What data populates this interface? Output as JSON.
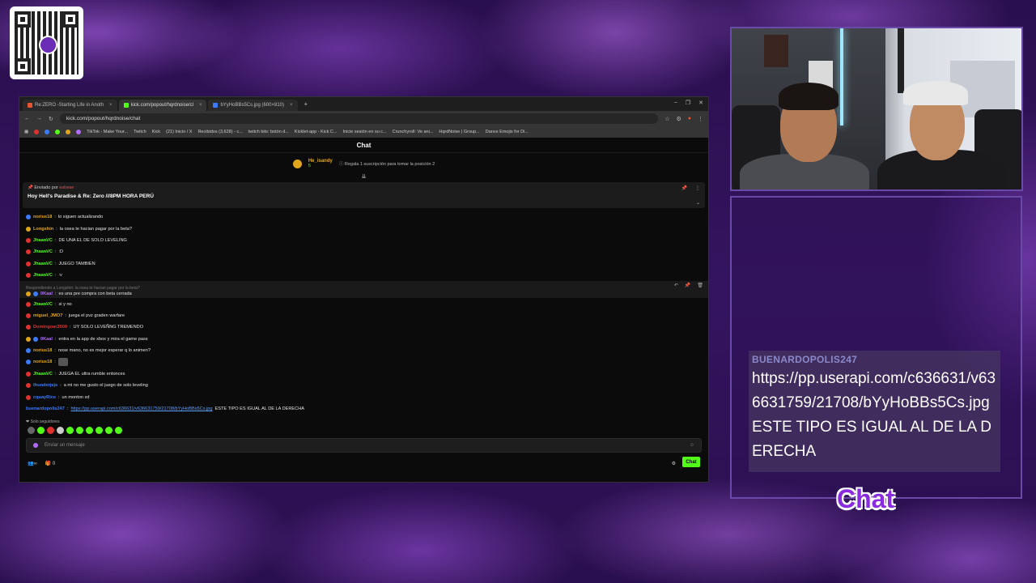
{
  "browser": {
    "tabs": [
      {
        "label": "Re:ZERO -Starting Life in Anoth",
        "color": "#e8542f"
      },
      {
        "label": "kick.com/popout/hqrdnoise/cl",
        "color": "#53fc18"
      },
      {
        "label": "bYyHoBBs5Cs.jpg (600×810)",
        "color": "#3b7cff"
      }
    ],
    "address": "kick.com/popout/hqrdnoise/chat",
    "bookmarks": [
      "TikTok - Make Your...",
      "Twitch",
      "Kick",
      "(21) Inicio / X",
      "Recibidos (3,628) - c...",
      "twitch bits: botón d...",
      "Kicklet-app - Kick C...",
      "Inicie sesión en su c...",
      "Crunchyroll: Ve ani...",
      "HqrdNoise | Group...",
      "Dance Emojis for Di..."
    ]
  },
  "chat": {
    "title": "Chat",
    "sub_user": "He_isandy",
    "sub_count": "5",
    "sub_text": "Regala 1 suscripción para tomar la posición 2",
    "pinned_by_label": "Enviado por",
    "pinned_by_user": "estrese",
    "pinned_title": "Hoy Hell's Paradise & Re: Zero ///8PM HORA PERÚ",
    "messages": [
      {
        "user": "norius18",
        "text": "lo siguen actualizando",
        "color": "#e0a61a"
      },
      {
        "user": "Longshin",
        "text": "la osea te hacian pagar por la beta?",
        "color": "#e0a61a"
      },
      {
        "user": "JhaanVC",
        "text": "DE UNA EL DE SOLO LEVELING",
        "color": "#53fc18"
      },
      {
        "user": "JhaanVC",
        "text": ":D",
        "color": "#53fc18"
      },
      {
        "user": "JhaanVC",
        "text": "JUEGO TAMBIEN",
        "color": "#53fc18"
      },
      {
        "user": "JhaanVC",
        "text": ":v",
        "color": "#53fc18"
      }
    ],
    "reply_to": "Respondiendo a Longshin: la osea te hacian pagar por la beta?",
    "reply_msg": {
      "user": "0Kaal",
      "text": "es una pre compra con beta cerrada",
      "color": "#b06cff"
    },
    "messages2": [
      {
        "user": "JhaanVC",
        "text": "si y no",
        "color": "#53fc18"
      },
      {
        "user": "miguel_JMO7",
        "text": "juega el pvz graden warfare",
        "color": "#e0a61a"
      },
      {
        "user": "Domingoar2000",
        "text": "UY SOLO LEVEÑNG TREMENDO",
        "color": "#e03131"
      },
      {
        "user": "0Kaal",
        "text": "entra en la app de xbox y mira el game pass",
        "color": "#b06cff"
      },
      {
        "user": "norius18",
        "text": "nose mano, no es mejor esperar q lo animen?",
        "color": "#e0a61a"
      },
      {
        "user": "norius18",
        "text": "",
        "color": "#e0a61a"
      },
      {
        "user": "JhaanVC",
        "text": "JUEGA EL ultra rumble entonces",
        "color": "#53fc18"
      },
      {
        "user": "thunderjsjs",
        "text": "a mi no me gusto el juego de solo leveling",
        "color": "#3b7cff"
      },
      {
        "user": "cquayRice",
        "text": "un monton xd",
        "color": "#3b7cff"
      }
    ],
    "last_user": "buenardopolis247",
    "last_link": "https://pp.userapi.com/c636631/v636631759/21708/bYyHoBBs5Cs.jpg",
    "last_text": "ESTE TIPO ES IGUAL AL DE LA DERECHA",
    "followers_only": "Solo seguidores",
    "input_placeholder": "Enviar un mensaje",
    "bottom_count": "0",
    "send_label": "Chat"
  },
  "overlay": {
    "user": "BUENARDOPOLIS247",
    "text": "https://pp.userapi.com/c636631/v636631759/21708/bYyHoBBs5Cs.jpg ESTE TIPO ES IGUAL AL DE LA DERECHA",
    "logo": "Chat"
  }
}
